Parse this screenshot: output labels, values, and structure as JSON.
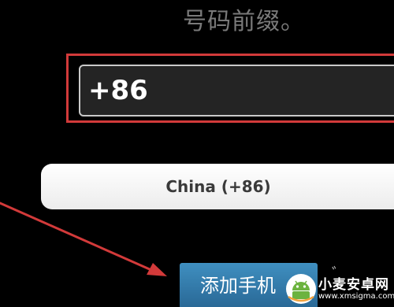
{
  "header": {
    "title": "号码前缀。"
  },
  "form": {
    "prefix_value": "+86",
    "country_label": "China (+86)",
    "add_phone_label": "添加手机"
  },
  "annotation": {
    "box_color": "#d23a3a",
    "arrow_color": "#d23a3a",
    "arrow_target": "add-phone-button"
  },
  "watermark": {
    "title": "小麦安卓网",
    "url": "www.xmsigma.com",
    "icon": "android-robot-icon"
  },
  "colors": {
    "background": "#000000",
    "button_accent": "#2f78ab",
    "input_background": "#242424"
  }
}
